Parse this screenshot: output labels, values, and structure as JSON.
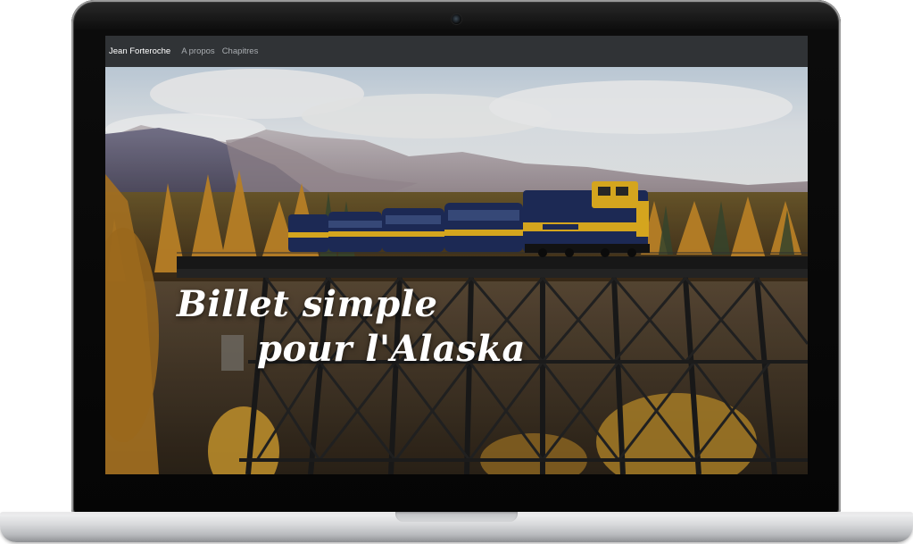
{
  "navbar": {
    "brand": "Jean Forteroche",
    "links": [
      {
        "label": "A propos"
      },
      {
        "label": "Chapitres"
      }
    ]
  },
  "hero": {
    "title_line1": "Billet simple",
    "title_line2": "pour l'Alaska"
  },
  "colors": {
    "navbar_bg": "#303336",
    "nav_link": "#a9adb1",
    "brand_text": "#ffffff",
    "train_blue": "#1f2d5c",
    "train_yellow": "#e6b421"
  }
}
